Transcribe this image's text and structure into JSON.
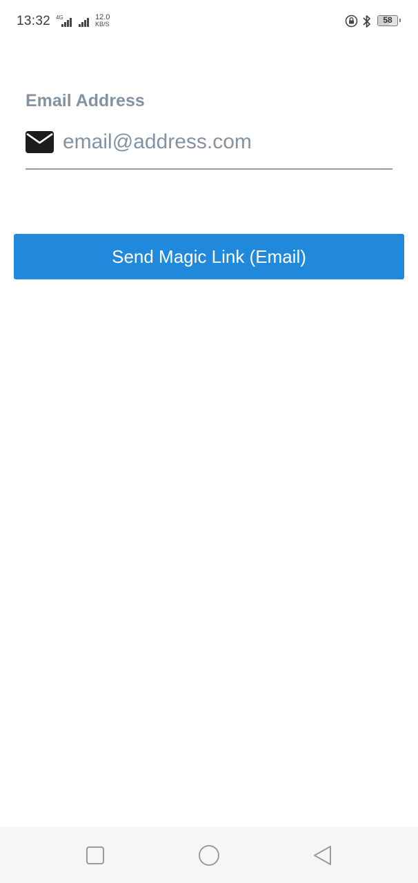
{
  "status_bar": {
    "time": "13:32",
    "network_type": "4G",
    "net_speed_value": "12.0",
    "net_speed_unit": "KB/S",
    "battery_level": "58",
    "icons": [
      "signal-icon",
      "signal-icon",
      "lock-rotation-icon",
      "bluetooth-icon",
      "battery-icon"
    ]
  },
  "form": {
    "email_label": "Email Address",
    "email_placeholder": "email@address.com",
    "email_value": "",
    "email_icon": "envelope-icon"
  },
  "actions": {
    "send_button_label": "Send Magic Link (Email)"
  },
  "nav_bar": {
    "icons": [
      "recent-apps-icon",
      "home-icon",
      "back-icon"
    ]
  },
  "colors": {
    "accent": "#2189dc",
    "label": "#8392a1",
    "underline": "#8e9aa6",
    "nav_background": "#f6f6f6"
  }
}
